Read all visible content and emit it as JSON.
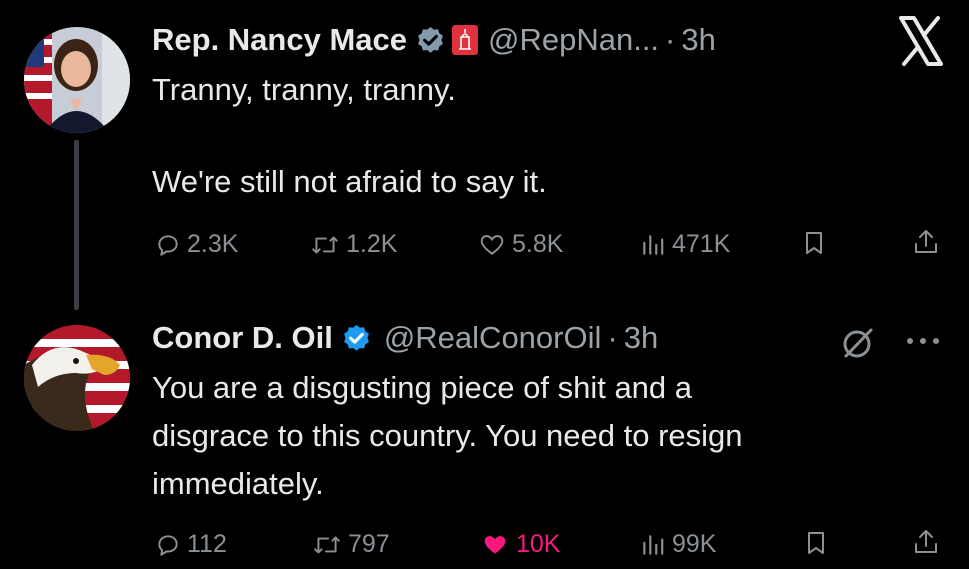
{
  "tweet1": {
    "name": "Rep. Nancy Mace",
    "handle": "@RepNan...",
    "dot": "·",
    "time": "3h",
    "line1": "Tranny, tranny, tranny.",
    "line2": "We're still not afraid to say it.",
    "replies": "2.3K",
    "retweets": "1.2K",
    "likes": "5.8K",
    "views": "471K"
  },
  "tweet2": {
    "name": "Conor D. Oil",
    "handle": "@RealConorOil",
    "dot": "·",
    "time": "3h",
    "line1": "You are a disgusting piece of shit and a",
    "line2": "disgrace to this country. You need to resign",
    "line3": "immediately.",
    "replies": "112",
    "retweets": "797",
    "likes": "10K",
    "views": "99K"
  },
  "colors": {
    "background": "#000000",
    "text": "#e7e9ea",
    "muted": "#8b9095",
    "verified_blue": "#1d9bf0",
    "verified_gray": "#829aab",
    "like_pink": "#f91880"
  },
  "icons": [
    "reply-icon",
    "retweet-icon",
    "like-icon",
    "views-icon",
    "bookmark-icon",
    "share-icon",
    "grok-icon",
    "more-icon",
    "x-logo"
  ]
}
